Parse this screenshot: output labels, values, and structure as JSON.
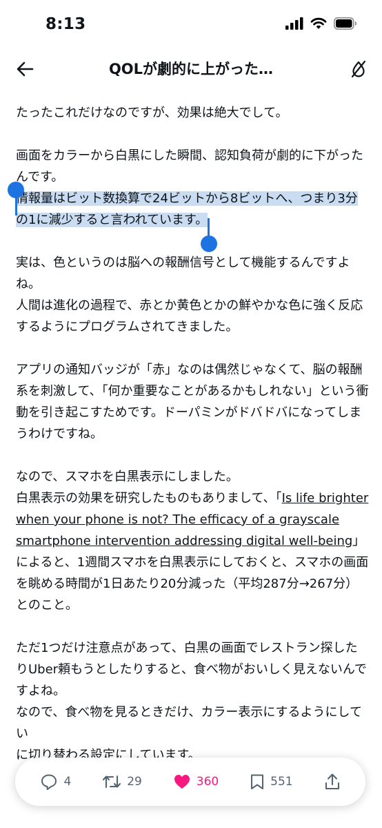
{
  "status": {
    "time": "8:13"
  },
  "header": {
    "title": "QOLが劇的に上がった…"
  },
  "article": {
    "p1": "たったこれだけなのですが、効果は絶大でして。",
    "p2a": "画面をカラーから白黒にした瞬間、認知負荷が劇的に下がったんです。",
    "p2b_selected": "情報量はビット数換算で24ビットから8ビットへ、つまり3分の1に減少すると言われています。",
    "p3a": "実は、色というのは脳への報酬信号として機能するんですよね。",
    "p3b": "人間は進化の過程で、赤とか黄色とかの鮮やかな色に強く反応するようにプログラムされてきました。",
    "p4": "アプリの通知バッジが「赤」なのは偶然じゃなくて、脳の報酬系を刺激して、「何か重要なことがあるかもしれない」という衝動を引き起こすためです。ドーパミンがドバドバになってしまうわけですね。",
    "p5a": "なので、スマホを白黒表示にしました。",
    "p5b_pre": "白黒表示の効果を研究したものもありまして、「",
    "p5b_link": "Is life brighter when your phone is not? The efficacy of a grayscale smartphone intervention addressing digital well-being",
    "p5b_post": "」によると、1週間スマホを白黒表示にしておくと、スマホの画面を眺める時間が1日あたり20分減った（平均287分→267分）とのこと。",
    "p6a": "ただ1つだけ注意点があって、白黒の画面でレストラン探したりUber頼もうとしたりすると、食べ物がおいしく見えないんですよね。",
    "p6b": "なので、食べ物を見るときだけ、カラー表示にするようにして",
    "p6c_hidden": "い",
    "p6d": "に切り替わる設定にしています。"
  },
  "actions": {
    "replies": "4",
    "reposts": "29",
    "likes": "360",
    "bookmarks": "551"
  },
  "colors": {
    "accent": "#1d74e0",
    "like": "#f91880",
    "selection": "#c9dcf2",
    "icon_gray": "#536471"
  },
  "icons": [
    "back-arrow-icon",
    "color-filter-off-icon",
    "reply-icon",
    "repost-icon",
    "heart-icon",
    "bookmark-icon",
    "share-icon"
  ]
}
